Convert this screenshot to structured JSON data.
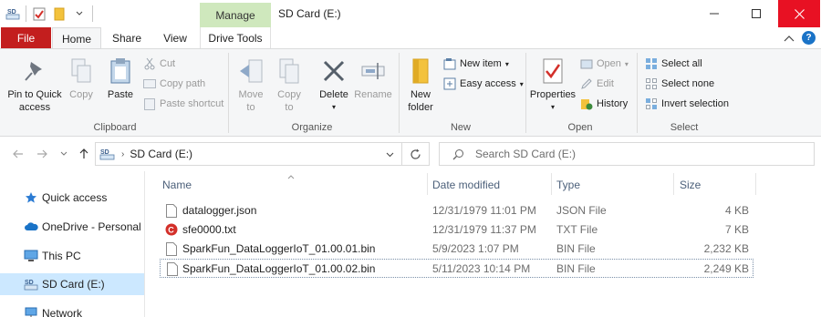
{
  "window": {
    "title": "SD Card (E:)",
    "context_tab": "Manage",
    "colors": {
      "file_tab": "#c31e1e",
      "manage_tab": "#cfe8bd",
      "close_btn": "#e81123",
      "selected_nav": "#cce8ff"
    }
  },
  "qat": {
    "app_icon": "SD",
    "items": [
      "properties-icon",
      "new-folder-icon",
      "dropdown-icon"
    ]
  },
  "tabs": {
    "file": "File",
    "home": "Home",
    "share": "Share",
    "view": "View",
    "drive_tools": "Drive Tools"
  },
  "ribbon": {
    "clipboard": {
      "label": "Clipboard",
      "pin": "Pin to Quick",
      "pin2": "access",
      "copy": "Copy",
      "paste": "Paste",
      "cut": "Cut",
      "copy_path": "Copy path",
      "paste_shortcut": "Paste shortcut"
    },
    "organize": {
      "label": "Organize",
      "move_to": "Move",
      "move_to2": "to",
      "copy_to": "Copy",
      "copy_to2": "to",
      "delete": "Delete",
      "rename": "Rename"
    },
    "new": {
      "label": "New",
      "new_folder": "New",
      "new_folder2": "folder",
      "new_item": "New item",
      "easy_access": "Easy access"
    },
    "open": {
      "label": "Open",
      "properties": "Properties",
      "open": "Open",
      "edit": "Edit",
      "history": "History"
    },
    "select": {
      "label": "Select",
      "select_all": "Select all",
      "select_none": "Select none",
      "invert": "Invert selection"
    }
  },
  "address": {
    "icon": "SD",
    "path": "SD Card (E:)",
    "search_placeholder": "Search SD Card (E:)"
  },
  "nav": [
    {
      "label": "Quick access",
      "icon": "star-icon"
    },
    {
      "label": "OneDrive - Personal",
      "icon": "cloud-icon"
    },
    {
      "label": "This PC",
      "icon": "pc-icon"
    },
    {
      "label": "SD Card (E:)",
      "icon": "sd-icon",
      "selected": true
    },
    {
      "label": "Network",
      "icon": "network-icon"
    }
  ],
  "columns": {
    "name": "Name",
    "date": "Date modified",
    "type": "Type",
    "size": "Size"
  },
  "files": [
    {
      "name": "datalogger.json",
      "date": "12/31/1979 11:01 PM",
      "type": "JSON File",
      "size": "4 KB",
      "icon": "json-file-icon"
    },
    {
      "name": "sfe0000.txt",
      "date": "12/31/1979 11:37 PM",
      "type": "TXT File",
      "size": "7 KB",
      "icon": "txt-file-icon"
    },
    {
      "name": "SparkFun_DataLoggerIoT_01.00.01.bin",
      "date": "5/9/2023 1:07 PM",
      "type": "BIN File",
      "size": "2,232 KB",
      "icon": "bin-file-icon"
    },
    {
      "name": "SparkFun_DataLoggerIoT_01.00.02.bin",
      "date": "5/11/2023 10:14 PM",
      "type": "BIN File",
      "size": "2,249 KB",
      "icon": "bin-file-icon"
    }
  ]
}
